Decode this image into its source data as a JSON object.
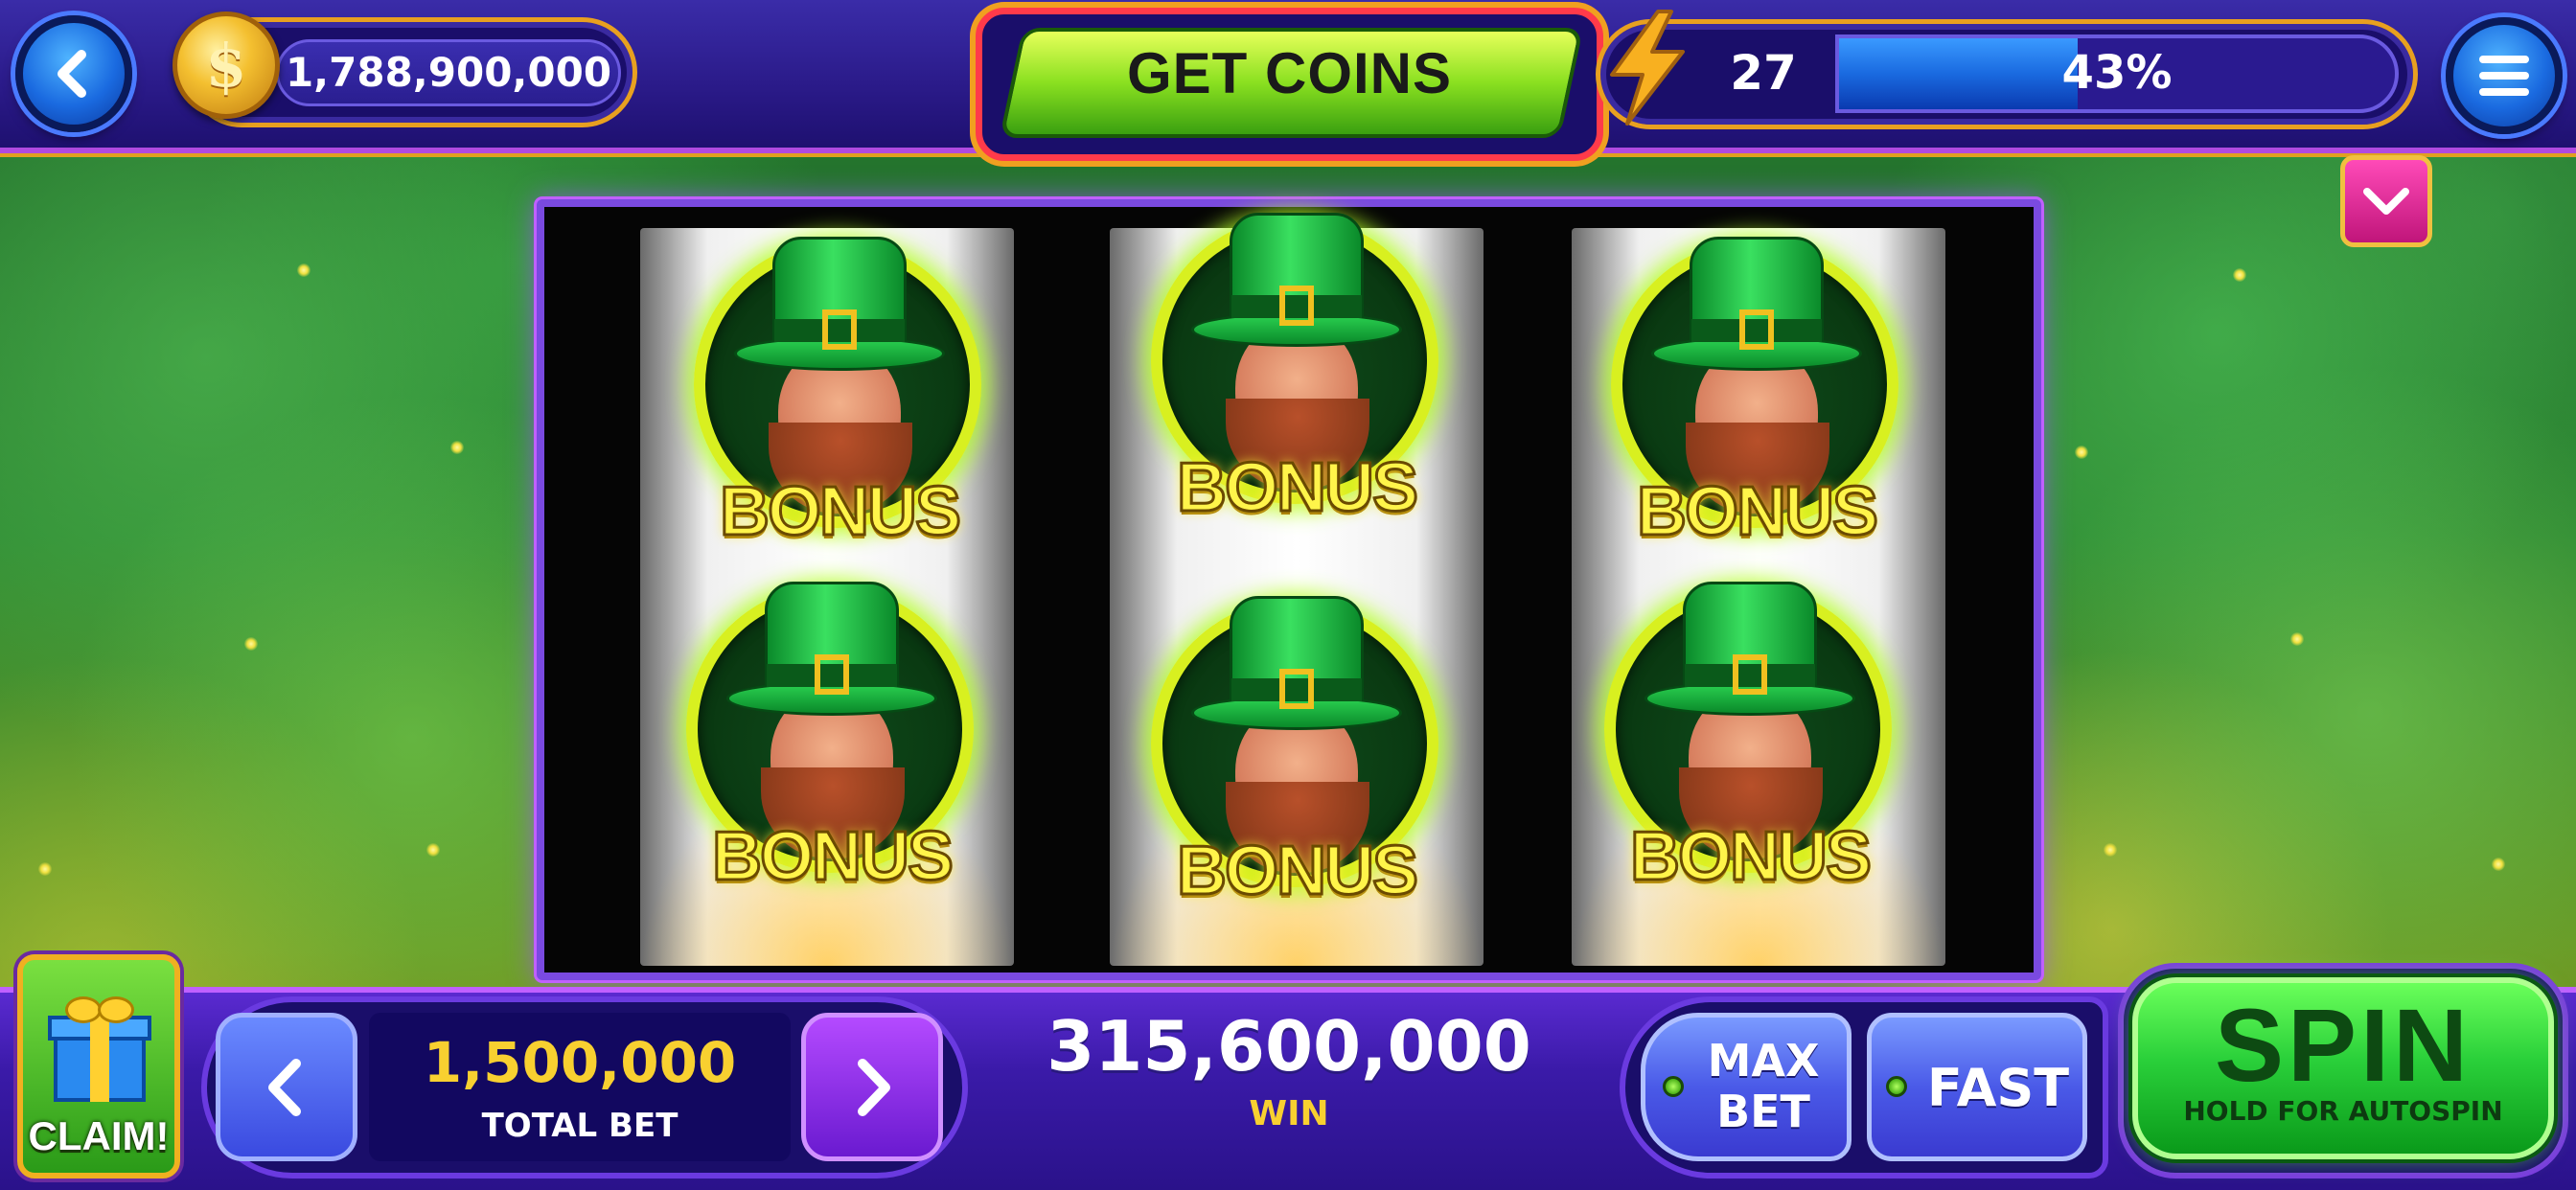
{
  "header": {
    "back_icon": "chevron-left-icon",
    "coin_balance": "1,788,900,000",
    "coin_icon": "dollar-coin-icon",
    "coin_symbol": "$",
    "get_coins_label": "GET COINS",
    "level": "27",
    "level_icon": "lightning-bolt-icon",
    "level_progress_text": "43%",
    "level_progress_fraction": 0.43,
    "menu_icon": "hamburger-menu-icon"
  },
  "reels": {
    "dropdown_icon": "chevron-down-icon",
    "symbols": [
      {
        "reel": 1,
        "row": 1,
        "label": "BONUS"
      },
      {
        "reel": 1,
        "row": 2,
        "label": "BONUS"
      },
      {
        "reel": 2,
        "row": 1,
        "label": "BONUS"
      },
      {
        "reel": 2,
        "row": 2,
        "label": "BONUS"
      },
      {
        "reel": 3,
        "row": 1,
        "label": "BONUS"
      },
      {
        "reel": 3,
        "row": 2,
        "label": "BONUS"
      }
    ]
  },
  "footer": {
    "claim_label": "CLAIM!",
    "gift_icon": "gift-box-icon",
    "bet_decrease_icon": "chevron-left-icon",
    "bet_increase_icon": "chevron-right-icon",
    "total_bet_value": "1,500,000",
    "total_bet_label": "TOTAL BET",
    "win_value": "315,600,000",
    "win_label": "WIN",
    "max_bet_line1": "MAX",
    "max_bet_line2": "BET",
    "fast_label": "FAST",
    "spin_label": "SPIN",
    "spin_sub": "HOLD FOR AUTOSPIN"
  },
  "colors": {
    "bonus_text": "#fff44a",
    "bet_value": "#f8d030",
    "spin_green": "#2ad03a",
    "level_fill": "#1a6ae0"
  }
}
